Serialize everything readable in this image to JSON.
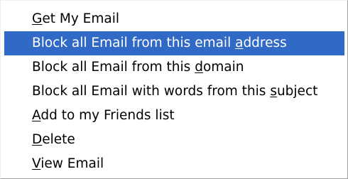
{
  "context_menu": {
    "highlight_color": "#3169c6",
    "items": [
      {
        "before": "",
        "mnemonic": "G",
        "after": "et My Email"
      },
      {
        "before": "Block all Email from this email ",
        "mnemonic": "a",
        "after": "ddress"
      },
      {
        "before": "Block all Email from this ",
        "mnemonic": "d",
        "after": "omain"
      },
      {
        "before": "Block all Email with words from this ",
        "mnemonic": "s",
        "after": "ubject"
      },
      {
        "before": "",
        "mnemonic": "A",
        "after": "dd to my Friends list"
      },
      {
        "before": "",
        "mnemonic": "D",
        "after": "elete"
      },
      {
        "before": "",
        "mnemonic": "V",
        "after": "iew Email"
      }
    ]
  }
}
